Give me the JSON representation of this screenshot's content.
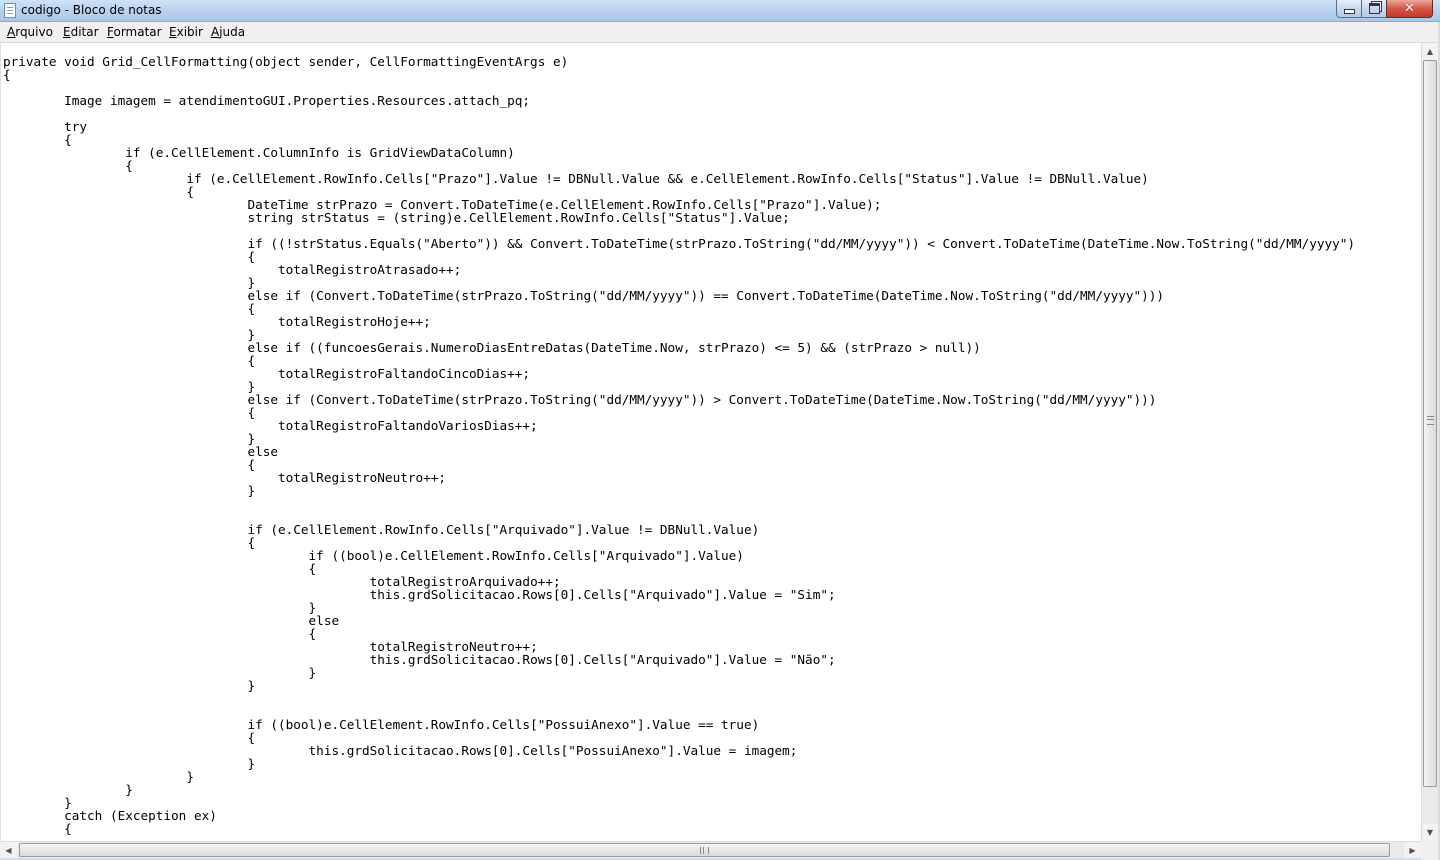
{
  "window": {
    "title": "codigo - Bloco de notas",
    "close_symbol": "✕"
  },
  "menu": {
    "items": [
      {
        "accel": "A",
        "rest": "rquivo"
      },
      {
        "accel": "E",
        "rest": "ditar"
      },
      {
        "accel": "F",
        "rest": "ormatar"
      },
      {
        "accel": "E",
        "rest": "xibir"
      },
      {
        "accel": "A",
        "rest": "juda"
      }
    ]
  },
  "editor": {
    "text": "private void Grid_CellFormatting(object sender, CellFormattingEventArgs e)\n{\n\n\tImage imagem = atendimentoGUI.Properties.Resources.attach_pq;\n\n\ttry\n\t{\n\t\tif (e.CellElement.ColumnInfo is GridViewDataColumn)\n\t\t{\n\t\t\tif (e.CellElement.RowInfo.Cells[\"Prazo\"].Value != DBNull.Value && e.CellElement.RowInfo.Cells[\"Status\"].Value != DBNull.Value)\n\t\t\t{\n\t\t\t\tDateTime strPrazo = Convert.ToDateTime(e.CellElement.RowInfo.Cells[\"Prazo\"].Value);\n\t\t\t\tstring strStatus = (string)e.CellElement.RowInfo.Cells[\"Status\"].Value;\n\n\t\t\t\tif ((!strStatus.Equals(\"Aberto\")) && Convert.ToDateTime(strPrazo.ToString(\"dd/MM/yyyy\")) < Convert.ToDateTime(DateTime.Now.ToString(\"dd/MM/yyyy\")\n\t\t\t\t{\n\t\t\t\t    totalRegistroAtrasado++;\n\t\t\t\t}\n\t\t\t\telse if (Convert.ToDateTime(strPrazo.ToString(\"dd/MM/yyyy\")) == Convert.ToDateTime(DateTime.Now.ToString(\"dd/MM/yyyy\")))\n\t\t\t\t{\n\t\t\t\t    totalRegistroHoje++;\n\t\t\t\t}\n\t\t\t\telse if ((funcoesGerais.NumeroDiasEntreDatas(DateTime.Now, strPrazo) <= 5) && (strPrazo > null))\n\t\t\t\t{\n\t\t\t\t    totalRegistroFaltandoCincoDias++;\n\t\t\t\t}\n\t\t\t\telse if (Convert.ToDateTime(strPrazo.ToString(\"dd/MM/yyyy\")) > Convert.ToDateTime(DateTime.Now.ToString(\"dd/MM/yyyy\")))\n\t\t\t\t{\n\t\t\t\t    totalRegistroFaltandoVariosDias++;\n\t\t\t\t}\n\t\t\t\telse\n\t\t\t\t{\n\t\t\t\t    totalRegistroNeutro++;\n\t\t\t\t}\n\n\n\t\t\t\tif (e.CellElement.RowInfo.Cells[\"Arquivado\"].Value != DBNull.Value)\n\t\t\t\t{\n\t\t\t\t\tif ((bool)e.CellElement.RowInfo.Cells[\"Arquivado\"].Value)\n\t\t\t\t\t{\n\t\t\t\t\t\ttotalRegistroArquivado++;\n\t\t\t\t\t\tthis.grdSolicitacao.Rows[0].Cells[\"Arquivado\"].Value = \"Sim\";\n\t\t\t\t\t}\n\t\t\t\t\telse\n\t\t\t\t\t{\n\t\t\t\t\t\ttotalRegistroNeutro++;\n\t\t\t\t\t\tthis.grdSolicitacao.Rows[0].Cells[\"Arquivado\"].Value = \"Não\";\n\t\t\t\t\t}\n\t\t\t\t}\n\n\n\t\t\t\tif ((bool)e.CellElement.RowInfo.Cells[\"PossuiAnexo\"].Value == true)\n\t\t\t\t{\n\t\t\t\t\tthis.grdSolicitacao.Rows[0].Cells[\"PossuiAnexo\"].Value = imagem;\n\t\t\t\t}\n\t\t\t}\n\t\t}\n\t}\n\tcatch (Exception ex)\n\t{"
  },
  "scrollbars": {
    "up_arrow": "▲",
    "down_arrow": "▼",
    "left_arrow": "◀",
    "right_arrow": "▶"
  },
  "colors": {
    "titlebar": "#b9d1ec",
    "menubar": "#f0f0f0",
    "editor_bg": "#ffffff",
    "text": "#000000",
    "close_button": "#c0392b"
  }
}
